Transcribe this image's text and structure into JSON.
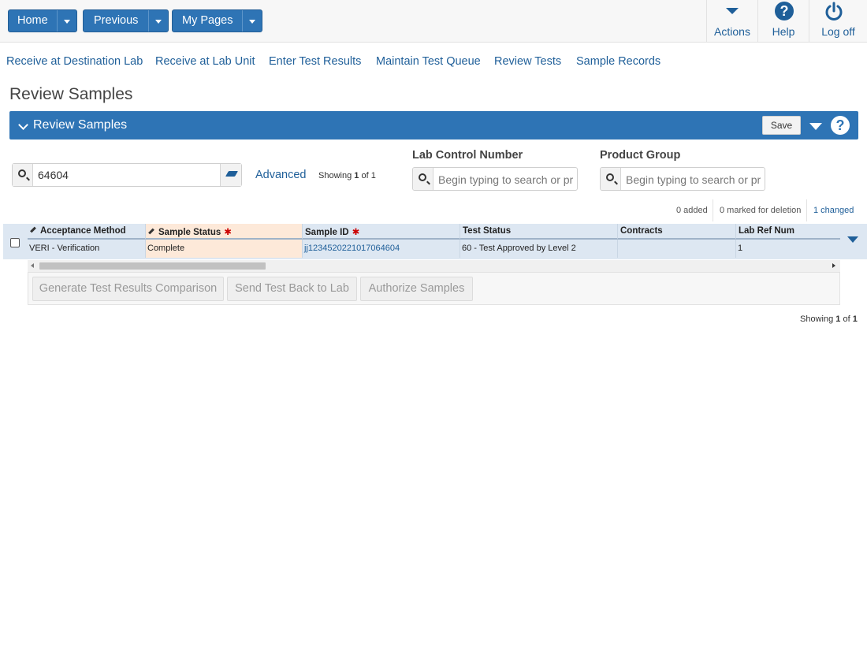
{
  "topnav": {
    "home": "Home",
    "previous": "Previous",
    "my_pages": "My Pages",
    "actions": "Actions",
    "help": "Help",
    "logoff": "Log off"
  },
  "subnav": [
    "Receive at Destination Lab",
    "Receive at Lab Unit",
    "Enter Test Results",
    "Maintain Test Queue",
    "Review Tests",
    "Sample Records"
  ],
  "page_title": "Review Samples",
  "panel": {
    "title": "Review Samples",
    "save": "Save"
  },
  "search": {
    "value": "64604",
    "advanced": "Advanced",
    "showing_prefix": "Showing ",
    "showing_num": "1",
    "showing_mid": " of ",
    "showing_total": "1"
  },
  "filters": {
    "lab_control": {
      "label": "Lab Control Number",
      "placeholder": "Begin typing to search or pr"
    },
    "product_group": {
      "label": "Product Group",
      "placeholder": "Begin typing to search or pr"
    }
  },
  "changes": {
    "added": "0 added",
    "deleted": "0 marked for deletion",
    "changed": "1 changed"
  },
  "grid": {
    "headers": [
      "Acceptance Method",
      "Sample Status",
      "Sample ID",
      "Test Status",
      "Contracts",
      "Lab Ref Num"
    ],
    "row": [
      "VERI - Verification",
      "Complete",
      "jj1234520221017064604",
      "60 - Test Approved by Level 2",
      "",
      "1"
    ]
  },
  "buttons": {
    "compare": "Generate Test Results Comparison",
    "send_back": "Send Test Back to Lab",
    "authorize": "Authorize Samples"
  },
  "footer": {
    "showing_prefix": "Showing ",
    "showing_num": "1",
    "showing_mid": " of ",
    "showing_total": "1"
  },
  "colors": {
    "primary": "#2e74b5",
    "link": "#1f5f99",
    "row_bg": "#dde7f2",
    "edit_cell": "#fde9d9",
    "required": "#cc0000"
  }
}
